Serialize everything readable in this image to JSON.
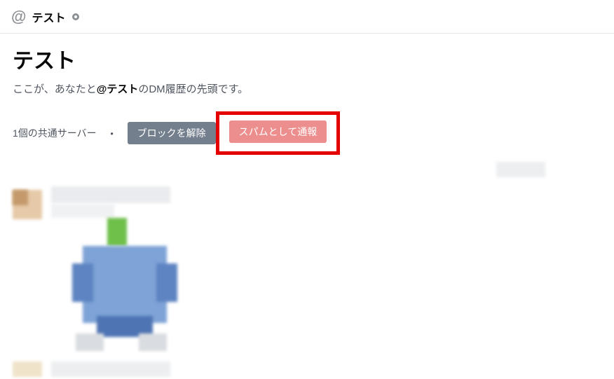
{
  "header": {
    "at_symbol": "@",
    "title": "テスト"
  },
  "dm_start": {
    "title": "テスト",
    "subtitle_before": "ここが、あなたと",
    "subtitle_mention": "@テスト",
    "subtitle_after": "のDM履歴の先頭です。"
  },
  "actions": {
    "mutual_servers": "1個の共通サーバー",
    "separator": "・",
    "unblock_label": "ブロックを解除",
    "report_spam_label": "スパムとして通報"
  }
}
